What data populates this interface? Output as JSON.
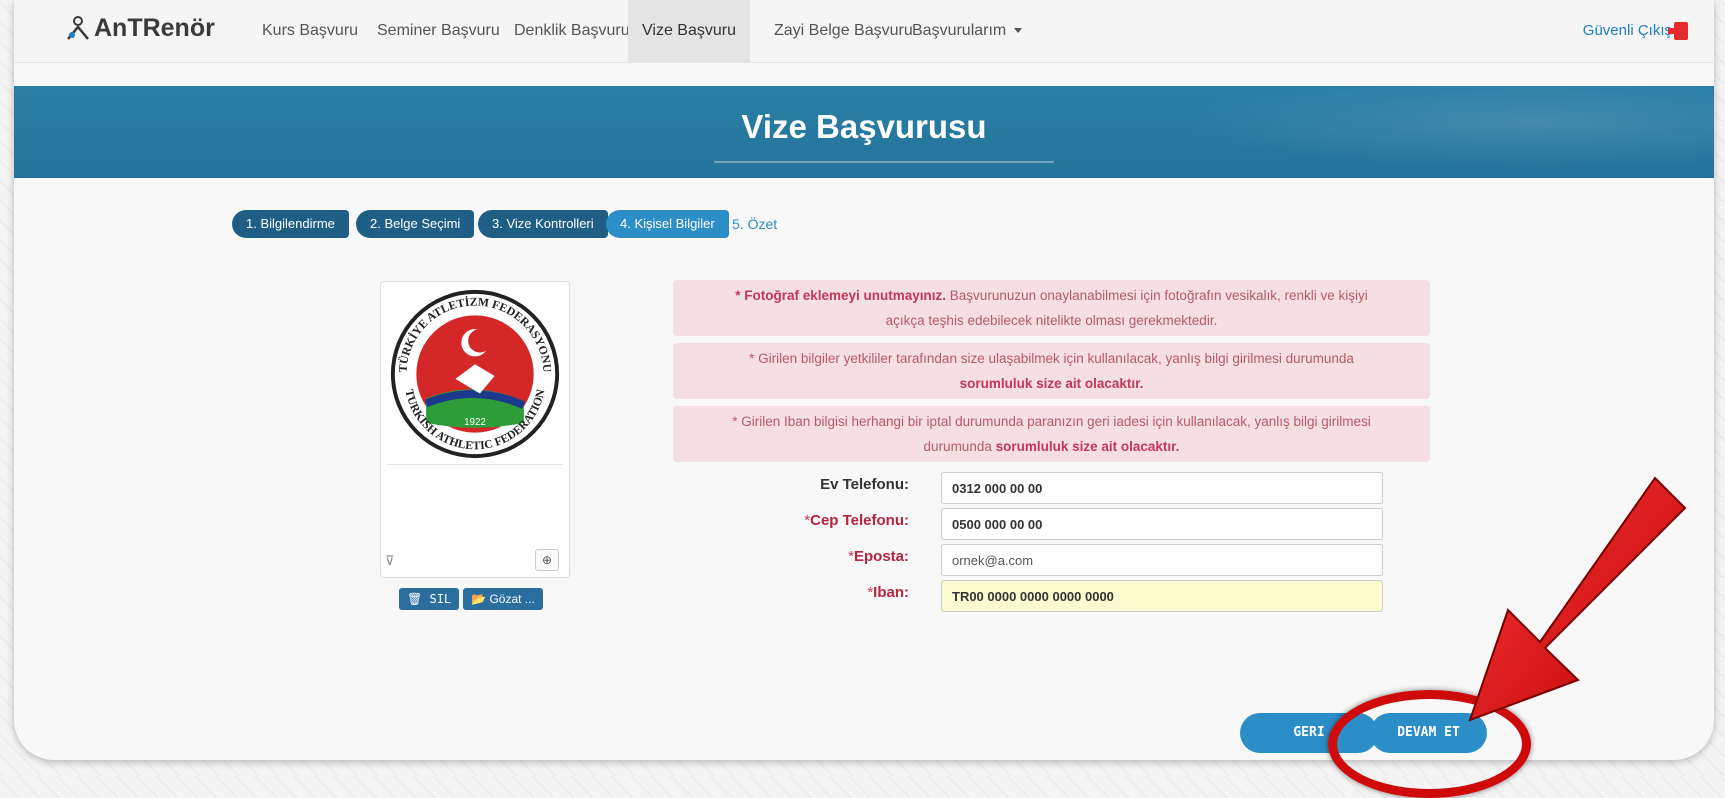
{
  "brand": {
    "logo_text": "AnTRenör"
  },
  "nav": {
    "items": [
      {
        "label": "Kurs Başvuru"
      },
      {
        "label": "Seminer Başvuru"
      },
      {
        "label": "Denklik Başvuru"
      },
      {
        "label": "Vize Başvuru",
        "active": true
      },
      {
        "label": "Zayi Belge Başvuru"
      },
      {
        "label": "Başvurularım"
      }
    ],
    "logout": "Güvenli Çıkış"
  },
  "page_title": "Vize Başvurusu",
  "steps": [
    {
      "label": "1. Bilgilendirme"
    },
    {
      "label": "2. Belge Seçimi"
    },
    {
      "label": "3. Vize Kontrolleri"
    },
    {
      "label": "4. Kişisel Bilgiler",
      "active": true
    },
    {
      "label": "5. Özet"
    }
  ],
  "photo": {
    "delete_label": "SIL",
    "browse_label": "Gözat ...",
    "logo_top_text": "TÜRKİYE ATLETİZM FEDERASYONU",
    "logo_bottom_text": "TURKISH ATHLETIC FEDERATION",
    "logo_year": "1922"
  },
  "alerts": [
    {
      "bold": "* Fotoğraf eklemeyi unutmayınız.",
      "line1_rest": " Başvurunuzun onaylanabilmesi için fotoğrafın vesikalık, renkli ve kişiyi",
      "line2": "açıkça teşhis edebilecek nitelikte olması gerekmektedir."
    },
    {
      "line1": "* Girilen bilgiler yetkililer tarafından size ulaşabilmek için kullanılacak, yanlış bilgi girilmesi durumunda",
      "line2_bold": "sorumluluk size ait olacaktır."
    },
    {
      "line1": "* Girilen Iban bilgisi herhangi bir iptal durumunda paranızın geri iadesi için kullanılacak, yanlış bilgi girilmesi",
      "line2_pre": "durumunda ",
      "line2_bold": "sorumluluk size ait olacaktır."
    }
  ],
  "form": {
    "home_phone": {
      "label": "Ev Telefonu:",
      "value": "0312 000 00 00"
    },
    "mobile_phone": {
      "label": "Cep Telefonu:",
      "value": "0500 000 00 00"
    },
    "email": {
      "label": "Eposta:",
      "value": "ornek@a.com"
    },
    "iban": {
      "label": "Iban:",
      "value": "TR00 0000 0000 0000 0000"
    }
  },
  "buttons": {
    "back": "GERI",
    "continue": "DEVAM ET"
  },
  "colors": {
    "primary": "#2b8ec6",
    "dark_step": "#1f5f86",
    "alert_bg": "#f6dfe3",
    "annotation_red": "#cf0a0a"
  }
}
